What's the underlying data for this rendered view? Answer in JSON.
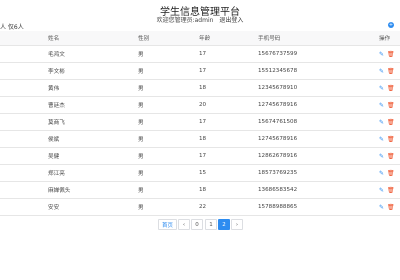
{
  "header": {
    "title": "学生信息管理平台",
    "welcome": "欢迎您管理员:admin",
    "logout": "退出登入",
    "count": "人 仅6人"
  },
  "table": {
    "columns": [
      "姓名",
      "性别",
      "年龄",
      "手机号码",
      "操作"
    ],
    "rows": [
      {
        "name": "毛鸿文",
        "sex": "男",
        "age": "17",
        "phone": "15676737599"
      },
      {
        "name": "李文彬",
        "sex": "男",
        "age": "17",
        "phone": "15512345678"
      },
      {
        "name": "黄伟",
        "sex": "男",
        "age": "18",
        "phone": "12345678910"
      },
      {
        "name": "曹廷杰",
        "sex": "男",
        "age": "20",
        "phone": "12745678916"
      },
      {
        "name": "莫商飞",
        "sex": "男",
        "age": "17",
        "phone": "15674761508"
      },
      {
        "name": "侯斌",
        "sex": "男",
        "age": "18",
        "phone": "12745678916"
      },
      {
        "name": "吴健",
        "sex": "男",
        "age": "17",
        "phone": "12862678916"
      },
      {
        "name": "郑江亮",
        "sex": "男",
        "age": "15",
        "phone": "18573769235"
      },
      {
        "name": "麻婵佩头",
        "sex": "男",
        "age": "18",
        "phone": "13686583542"
      },
      {
        "name": "安安",
        "sex": "男",
        "age": "22",
        "phone": "15788988865"
      }
    ]
  },
  "icons": {
    "edit": "pencil-icon",
    "delete": "trash-icon",
    "add": "plus-icon"
  },
  "pagination": {
    "first": "首页",
    "prev": "‹",
    "pages": [
      "0",
      "1",
      "2"
    ],
    "current": "2",
    "next": "›"
  },
  "colors": {
    "accent": "#2d8cf0",
    "danger": "#ed4014"
  }
}
